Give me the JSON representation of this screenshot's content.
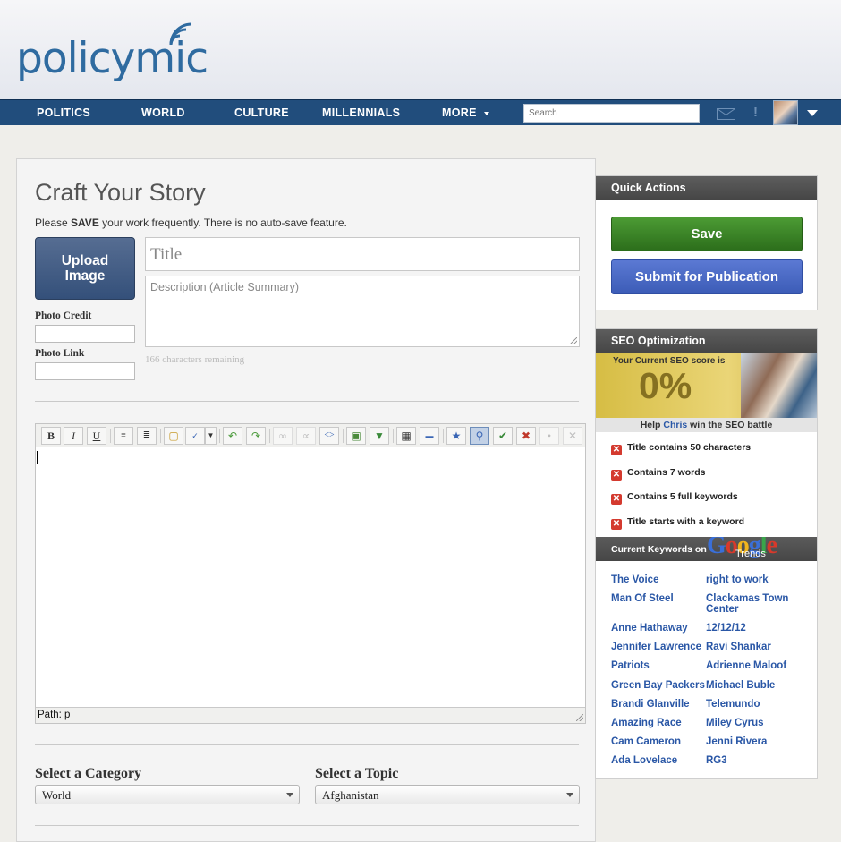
{
  "header": {
    "logo": "policymic",
    "search_placeholder": "Search",
    "alert": "!"
  },
  "nav": {
    "items": [
      "POLITICS",
      "WORLD",
      "CULTURE",
      "MILLENNIALS",
      "MORE"
    ]
  },
  "main": {
    "title": "Craft Your Story",
    "save_note_prefix": "Please ",
    "save_note_bold": "SAVE",
    "save_note_suffix": " your work frequently. There is no auto-save feature.",
    "upload_label_1": "Upload",
    "upload_label_2": "Image",
    "photo_credit_label": "Photo Credit",
    "photo_link_label": "Photo Link",
    "title_placeholder": "Title",
    "description_placeholder": "Description (Article Summary)",
    "chars_remaining": "166 characters remaining",
    "editor_path": "Path: p",
    "category_label": "Select a Category",
    "category_value": "World",
    "topic_label": "Select a Topic",
    "topic_value": "Afghanistan"
  },
  "quick_actions": {
    "heading": "Quick Actions",
    "save_label": "Save",
    "submit_label": "Submit for Publication"
  },
  "seo": {
    "heading": "SEO Optimization",
    "score_label": "Your Current SEO score is",
    "score_value": "0%",
    "help_prefix": "Help ",
    "help_name": "Chris",
    "help_suffix": " win the SEO battle",
    "checks": [
      "Title contains 50 characters",
      "Contains 7 words",
      "Contains 5 full keywords",
      "Title starts with a keyword"
    ]
  },
  "keywords": {
    "heading": "Current Keywords on",
    "google": "Google",
    "trends": "Trends",
    "left": [
      "The Voice",
      "Man Of Steel",
      "Anne Hathaway",
      "Jennifer Lawrence",
      "Patriots",
      "Green Bay Packers",
      "Brandi Glanville",
      "Amazing Race",
      "Cam Cameron",
      "Ada Lovelace"
    ],
    "right": [
      "right to work",
      "Clackamas Town Center",
      "12/12/12",
      "Ravi Shankar",
      "Adrienne Maloof",
      "Michael Buble",
      "Telemundo",
      "Miley Cyrus",
      "Jenni Rivera",
      "RG3"
    ]
  },
  "colors": {
    "brand": "#2f6ba0",
    "nav": "#214d7c",
    "save": "#3a8427",
    "submit": "#4a6bc6",
    "keyword": "#2a57a6"
  }
}
